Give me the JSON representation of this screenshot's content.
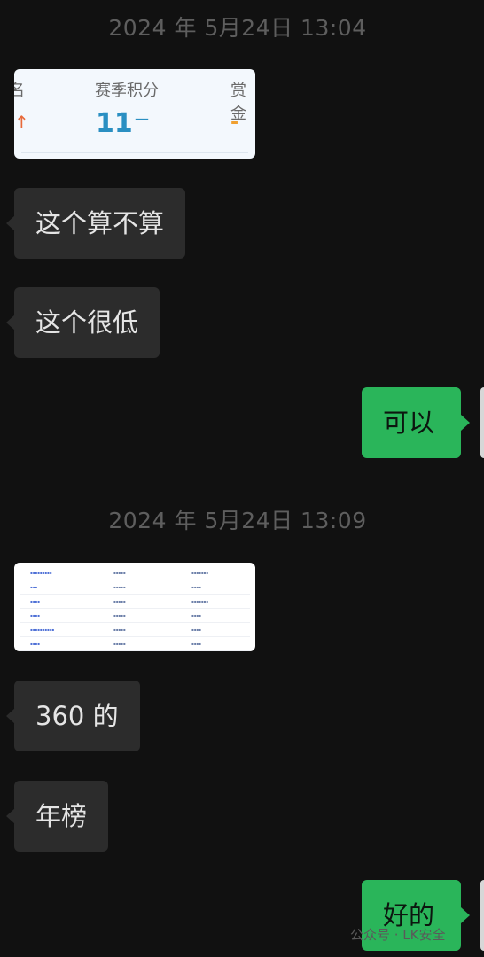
{
  "messages": {
    "timestamp_1": "2024 年 5月24日 13:04",
    "img1": {
      "rank_fragment": "名",
      "rank_arrow": "↑",
      "season_points_label": "赛季积分",
      "season_points_value": "11",
      "season_points_change": "—",
      "bounty_label": "赏金",
      "bounty_value": "-"
    },
    "msg_1": "这个算不算",
    "msg_2": "这个很低",
    "msg_3": "可以",
    "timestamp_2": "2024 年 5月24日 13:09",
    "msg_4": "360 的",
    "msg_5": "年榜",
    "msg_6": "好的"
  },
  "watermark": "公众号 · LK安全",
  "colors": {
    "background": "#111111",
    "incoming_bubble": "#2c2c2c",
    "outgoing_bubble": "#2ab55a",
    "timestamp": "#5e5e5e",
    "points_blue": "#2a8fc2",
    "bounty_orange": "#f0a030",
    "arrow_orange": "#e86a3a"
  }
}
